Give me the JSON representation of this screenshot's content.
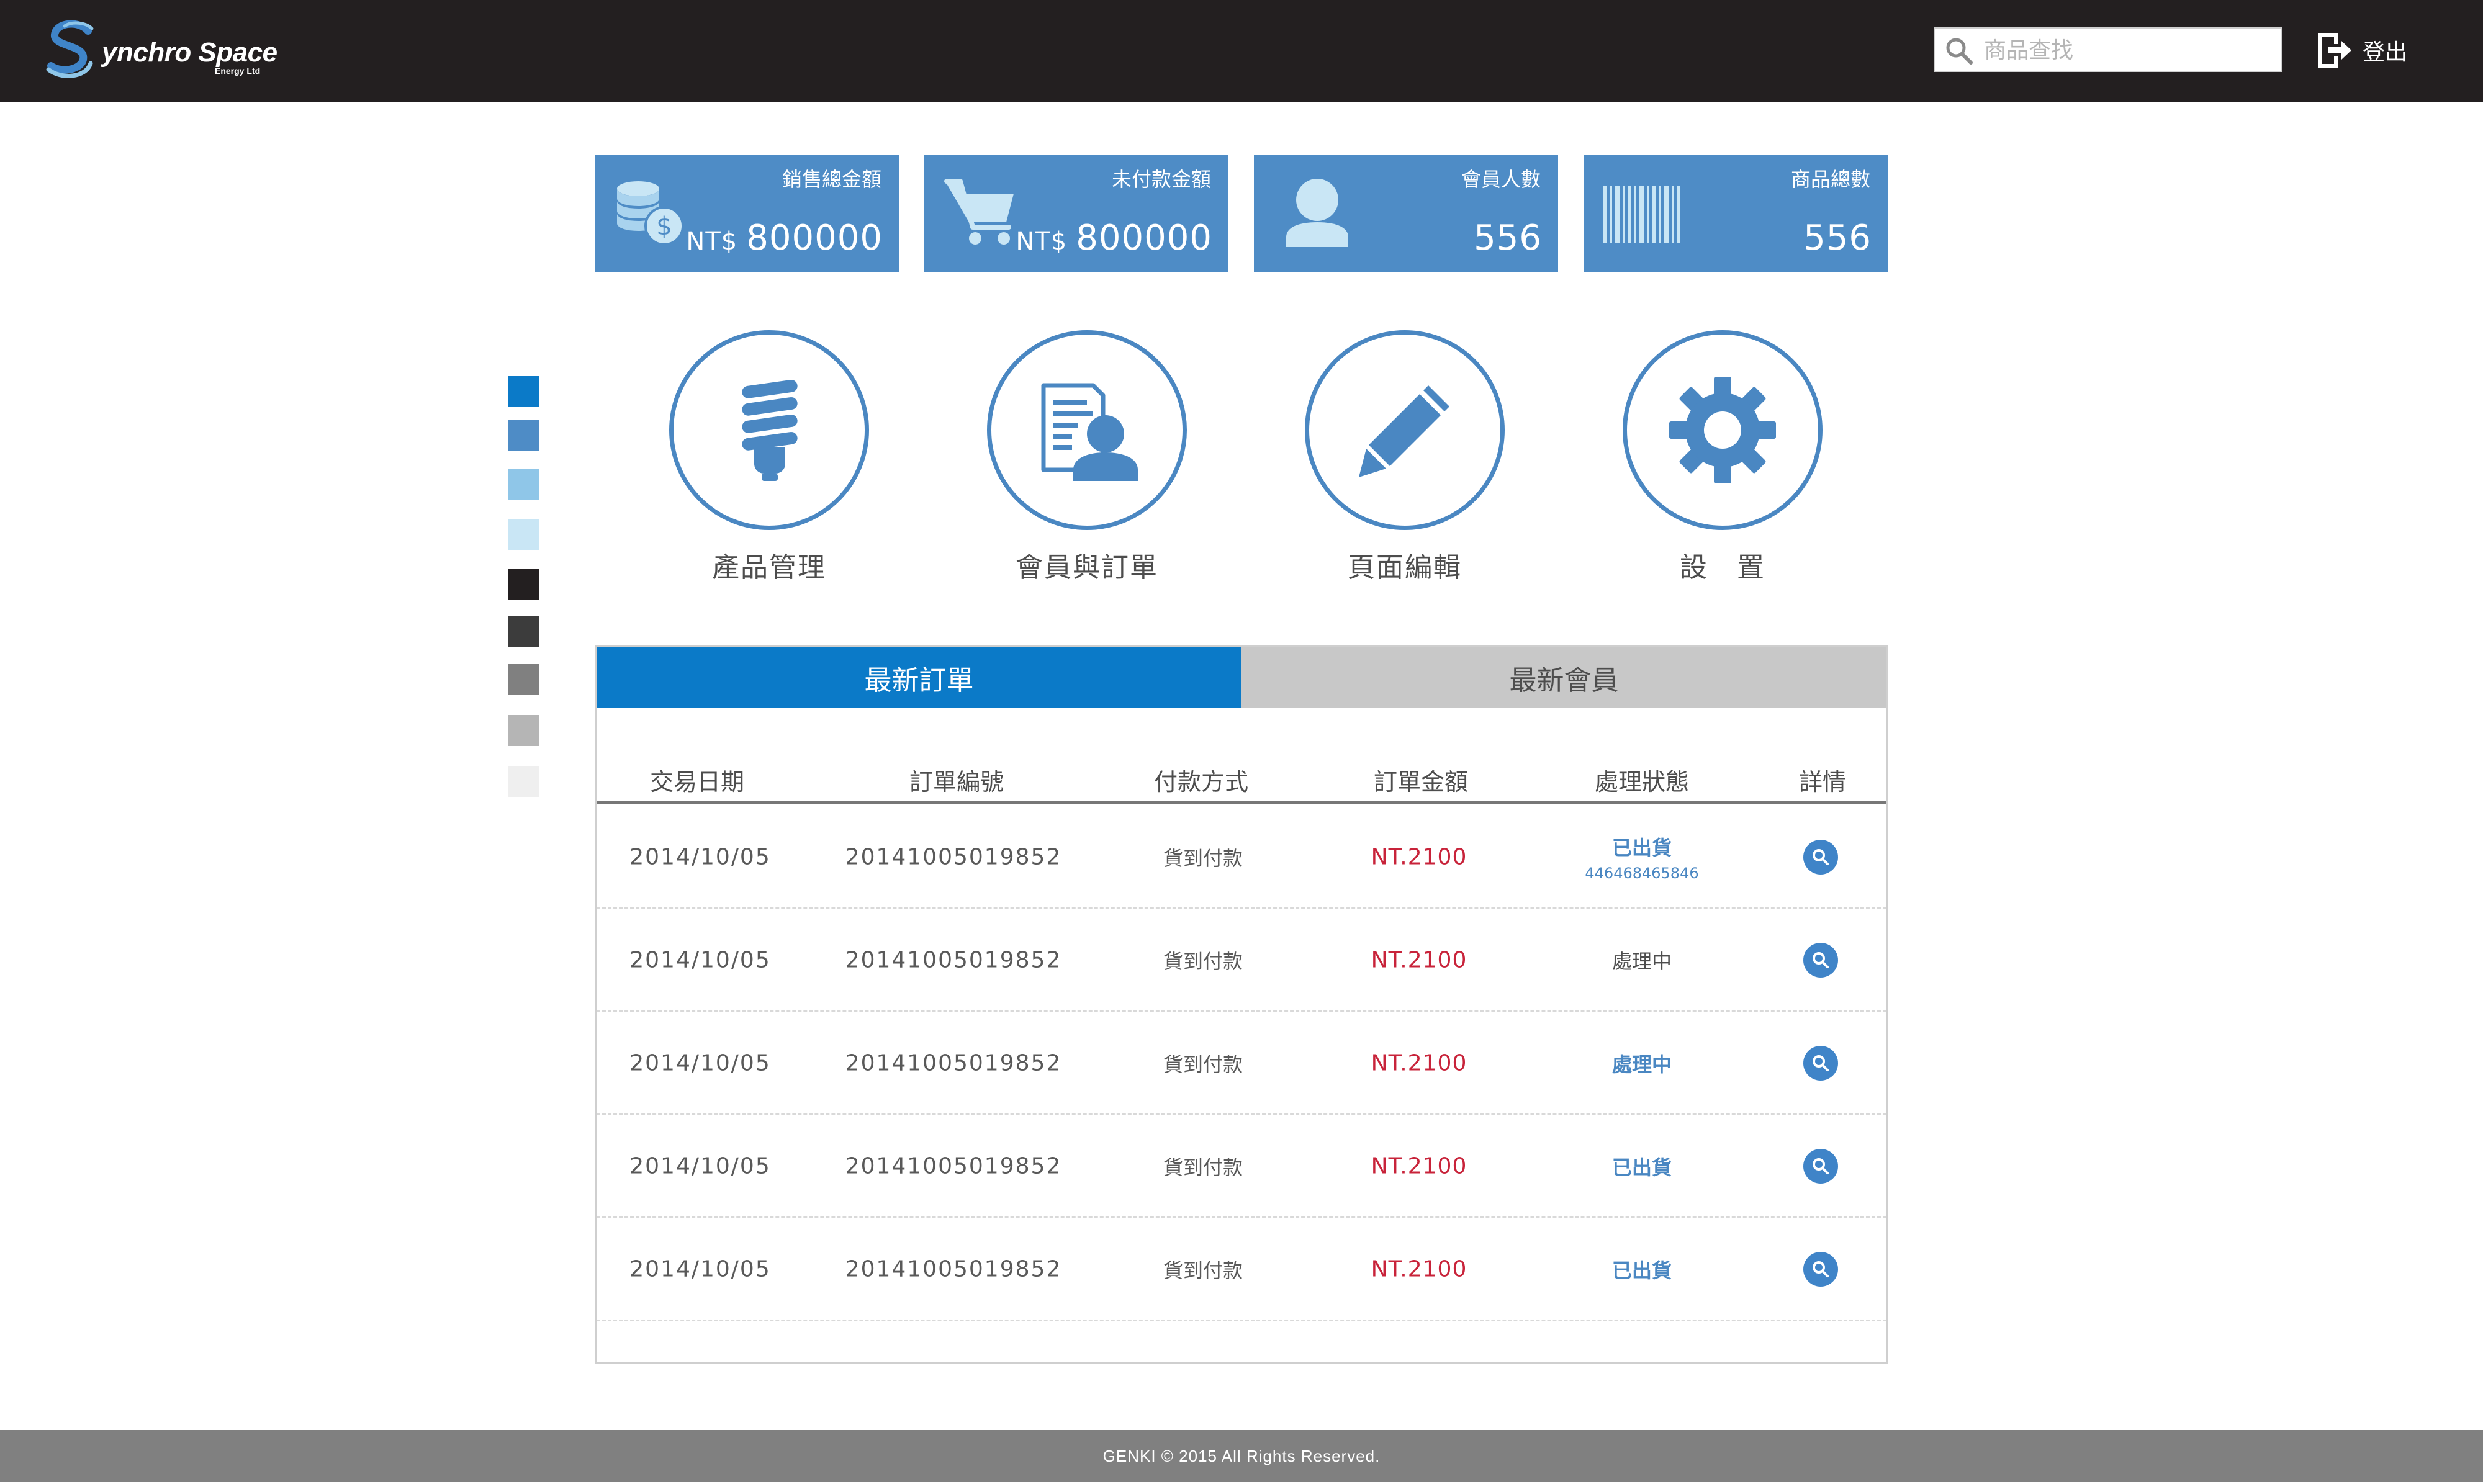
{
  "header": {
    "logo_text": "ynchro Space",
    "logo_sub": "Energy Ltd",
    "search_placeholder": "商品查找",
    "logout_label": "登出"
  },
  "stats": [
    {
      "label": "銷售總金額",
      "prefix": "NT$",
      "value": "800000",
      "icon": "coins-dollar-icon"
    },
    {
      "label": "未付款金額",
      "prefix": "NT$",
      "value": "800000",
      "icon": "shopping-cart-icon"
    },
    {
      "label": "會員人數",
      "prefix": "",
      "value": "556",
      "icon": "user-icon"
    },
    {
      "label": "商品總數",
      "prefix": "",
      "value": "556",
      "icon": "barcode-icon"
    }
  ],
  "palette": [
    "#0b7ac8",
    "#4e8cc6",
    "#8fc6e8",
    "#c9e6f5",
    "#231f20",
    "#3c3c3c",
    "#808080",
    "#b5b5b5",
    "#efefef"
  ],
  "nav": [
    {
      "label": "產品管理",
      "icon": "light-bulb-icon"
    },
    {
      "label": "會員與訂單",
      "icon": "member-document-icon"
    },
    {
      "label": "頁面編輯",
      "icon": "pencil-icon"
    },
    {
      "label": "設　置",
      "icon": "gear-icon"
    }
  ],
  "tabs": {
    "active": "最新訂單",
    "inactive": "最新會員"
  },
  "table": {
    "columns": [
      "交易日期",
      "訂單編號",
      "付款方式",
      "訂單金額",
      "處理狀態",
      "詳情"
    ],
    "rows": [
      {
        "date": "2014/10/05",
        "order_no": "20141005019852",
        "payment": "貨到付款",
        "amount": "NT.2100",
        "status": "已出貨",
        "tracking": "446468465846",
        "status_color": "#4a87c2"
      },
      {
        "date": "2014/10/05",
        "order_no": "20141005019852",
        "payment": "貨到付款",
        "amount": "NT.2100",
        "status": "處理中",
        "tracking": "",
        "status_color": "#4d4d4d"
      },
      {
        "date": "2014/10/05",
        "order_no": "20141005019852",
        "payment": "貨到付款",
        "amount": "NT.2100",
        "status": "處理中",
        "tracking": "",
        "status_color": "#4a87c2"
      },
      {
        "date": "2014/10/05",
        "order_no": "20141005019852",
        "payment": "貨到付款",
        "amount": "NT.2100",
        "status": "已出貨",
        "tracking": "",
        "status_color": "#4a87c2"
      },
      {
        "date": "2014/10/05",
        "order_no": "20141005019852",
        "payment": "貨到付款",
        "amount": "NT.2100",
        "status": "已出貨",
        "tracking": "",
        "status_color": "#4a87c2"
      }
    ]
  },
  "footer": {
    "text": "GENKI © 2015  All Rights Reserved."
  }
}
